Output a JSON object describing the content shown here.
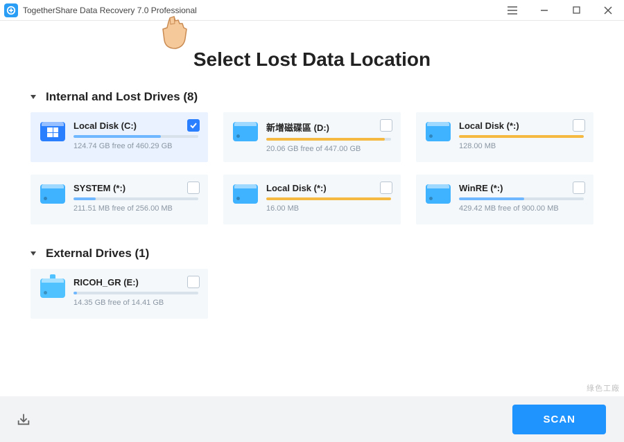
{
  "window": {
    "title": "TogetherShare Data Recovery 7.0 Professional"
  },
  "page": {
    "title": "Select Lost Data Location"
  },
  "sections": [
    {
      "label": "Internal and Lost Drives (8)",
      "id": "internal",
      "drives": [
        {
          "name": "Local Disk (C:)",
          "info": "124.74 GB free of 460.29 GB",
          "icon": "windows",
          "bar_color": "#6fb8ff",
          "bar_pct": 70,
          "checked": true
        },
        {
          "name": "新增磁碟區 (D:)",
          "info": "20.06 GB free of 447.00 GB",
          "icon": "internal",
          "bar_color": "#f5b942",
          "bar_pct": 95,
          "checked": false
        },
        {
          "name": "Local Disk (*:)",
          "info": "128.00 MB",
          "icon": "internal",
          "bar_color": "#f5b942",
          "bar_pct": 100,
          "checked": false
        },
        {
          "name": "SYSTEM (*:)",
          "info": "211.51 MB free of 256.00 MB",
          "icon": "internal",
          "bar_color": "#6fb8ff",
          "bar_pct": 18,
          "checked": false
        },
        {
          "name": "Local Disk (*:)",
          "info": "16.00 MB",
          "icon": "internal",
          "bar_color": "#f5b942",
          "bar_pct": 100,
          "checked": false
        },
        {
          "name": "WinRE (*:)",
          "info": "429.42 MB free of 900.00 MB",
          "icon": "internal",
          "bar_color": "#6fb8ff",
          "bar_pct": 52,
          "checked": false
        }
      ]
    },
    {
      "label": "External Drives (1)",
      "id": "external",
      "drives": [
        {
          "name": "RICOH_GR (E:)",
          "info": "14.35 GB free of 14.41 GB",
          "icon": "external",
          "bar_color": "#6fb8ff",
          "bar_pct": 3,
          "checked": false
        }
      ]
    }
  ],
  "actions": {
    "scan_label": "SCAN"
  },
  "watermark": "綠色工廠"
}
